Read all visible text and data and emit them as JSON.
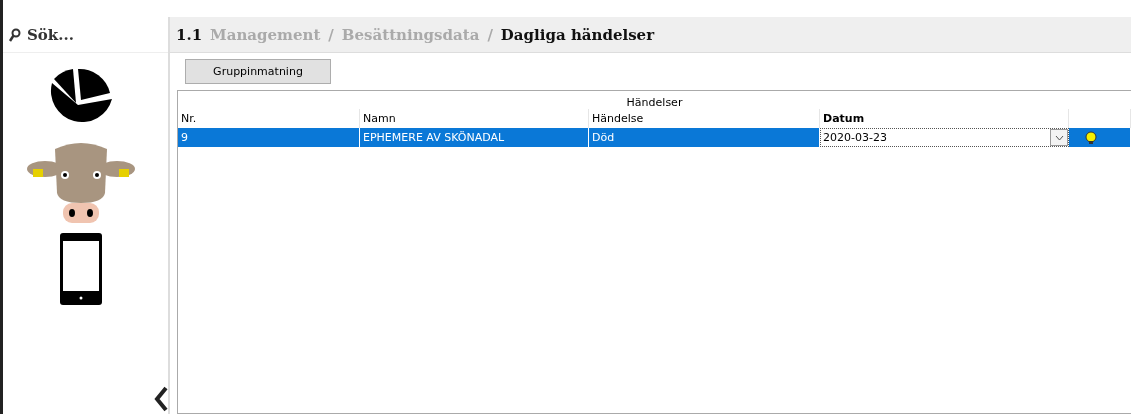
{
  "sidebar": {
    "search_placeholder": "Sök..."
  },
  "breadcrumb": {
    "number": "1.1",
    "items": [
      {
        "label": "Management",
        "current": false
      },
      {
        "label": "Besättningsdata",
        "current": false
      },
      {
        "label": "Dagliga händelser",
        "current": true
      }
    ],
    "separator": "/"
  },
  "toolbar": {
    "buttons": [
      "Gruppinmatning"
    ]
  },
  "table": {
    "group_header": "Händelser",
    "columns": [
      {
        "label": "Nr.",
        "bold": false
      },
      {
        "label": "Namn",
        "bold": false
      },
      {
        "label": "Händelse",
        "bold": false
      },
      {
        "label": "Datum",
        "bold": true
      }
    ],
    "rows": [
      {
        "nr": "9",
        "name": "EPHEMERE AV SKÖNADAL",
        "event": "Död",
        "date": "2020-03-23",
        "selected": true
      }
    ]
  }
}
